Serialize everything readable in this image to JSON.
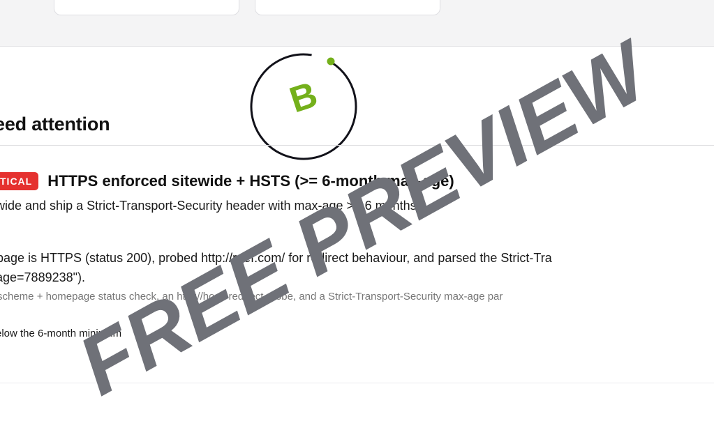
{
  "header": {
    "section_title": "eed attention"
  },
  "grade": {
    "letter": "B",
    "accent_color": "#74b01b",
    "ring_color": "#12121a"
  },
  "finding": {
    "severity": "TICAL",
    "severity_color": "#e5312f",
    "title": "HTTPS enforced sitewide + HSTS (>= 6-month max-age)",
    "description": "wide and ship a Strict-Transport-Security header with max-age >= 6 months",
    "evidence_line_1": "page is HTTPS (status 200), probed http://reef.com/ for redirect behaviour, and parsed the Strict-Tra",
    "evidence_line_2": "age=7889238\").",
    "method": "scheme + homepage status check, an http://host/ redirect probe, and a Strict-Transport-Security max-age par",
    "result": "elow the 6-month minimum"
  },
  "watermark": {
    "text": "FREE PREVIEW",
    "color": "#6f7178"
  }
}
